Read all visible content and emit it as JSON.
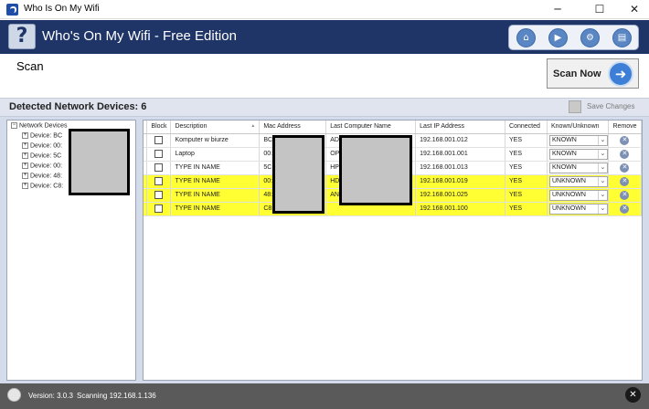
{
  "window": {
    "title": "Who Is On My Wifi",
    "minimize_glyph": "─",
    "maximize_glyph": "☐",
    "close_glyph": "✕"
  },
  "header": {
    "logo_glyph": "?",
    "app_name": "Who's On My Wifi - Free Edition",
    "nav_icons": [
      "home-icon",
      "play-icon",
      "gear-icon",
      "document-icon"
    ]
  },
  "scan": {
    "title": "Scan",
    "button_label": "Scan Now",
    "button_glyph": "➜"
  },
  "detected": {
    "label": "Detected Network Devices: 6",
    "save_label": "Save Changes"
  },
  "tree": {
    "root": "Network Devices",
    "items": [
      "Device: BC",
      "Device: 00:",
      "Device: 5C",
      "Device: 00:",
      "Device: 48:",
      "Device: C8:"
    ]
  },
  "table": {
    "columns": {
      "block": "Block",
      "description": "Description",
      "mac": "Mac Address",
      "computer": "Last Computer Name",
      "ip": "Last IP Address",
      "connected": "Connected",
      "known": "Known/Unknown",
      "remove": "Remove"
    },
    "sort_glyph": "▲",
    "dropdown_glyph": "⌄",
    "remove_glyph": "✕",
    "rows": [
      {
        "description": "Komputer w biurze",
        "mac": "BC",
        "computer": "AD",
        "ip": "192.168.001.012",
        "connected": "YES",
        "known": "KNOWN",
        "highlight": false
      },
      {
        "description": "Laptop",
        "mac": "00:",
        "computer": "OP",
        "ip": "192.168.001.001",
        "connected": "YES",
        "known": "KNOWN",
        "highlight": false
      },
      {
        "description": "TYPE IN NAME",
        "mac": "5C",
        "computer": "HP",
        "ip": "192.168.001.013",
        "connected": "YES",
        "known": "KNOWN",
        "highlight": false
      },
      {
        "description": "TYPE IN NAME",
        "mac": "00:",
        "computer": "HD",
        "ip": "192.168.001.019",
        "connected": "YES",
        "known": "UNKNOWN",
        "highlight": true
      },
      {
        "description": "TYPE IN NAME",
        "mac": "48:",
        "computer": "AN",
        "ip": "192.168.001.025",
        "connected": "YES",
        "known": "UNKNOWN",
        "highlight": true
      },
      {
        "description": "TYPE IN NAME",
        "mac": "C8:",
        "computer": "",
        "ip": "192.168.001.100",
        "connected": "YES",
        "known": "UNKNOWN",
        "highlight": true
      }
    ]
  },
  "status": {
    "version": "Version: 3.0.3",
    "scanning": "Scanning 192.168.1.136",
    "close_glyph": "✕"
  },
  "colors": {
    "header_bg": "#1f3568",
    "highlight": "#ffff33",
    "status_bg": "#5a5a5a"
  }
}
